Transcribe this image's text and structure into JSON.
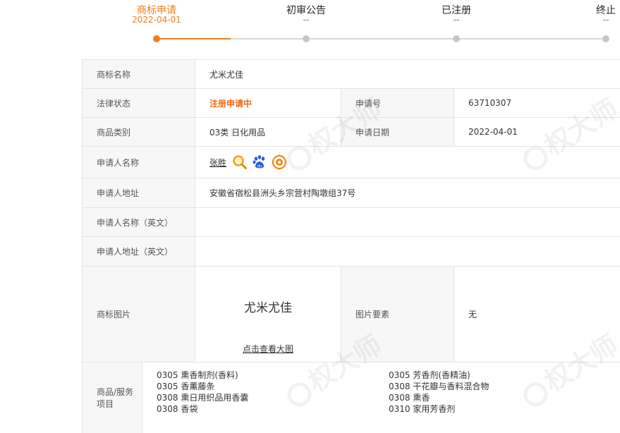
{
  "steps": [
    {
      "label": "商标申请",
      "date": "2022-04-01",
      "active": true
    },
    {
      "label": "初审公告",
      "date": "--",
      "active": false
    },
    {
      "label": "已注册",
      "date": "--",
      "active": false
    },
    {
      "label": "终止",
      "date": "--",
      "active": false
    }
  ],
  "info": {
    "name_label": "商标名称",
    "name_value": "尤米尤佳",
    "legal_status_label": "法律状态",
    "legal_status_value": "注册申请中",
    "app_no_label": "申请号",
    "app_no_value": "63710307",
    "category_label": "商品类别",
    "category_value": "03类 日化用品",
    "app_date_label": "申请日期",
    "app_date_value": "2022-04-01",
    "applicant_label": "申请人名称",
    "applicant_value": "张胜",
    "address_label": "申请人地址",
    "address_value": "安徽省宿松县洲头乡宗营村陶墩组37号",
    "applicant_en_label": "申请人名称（英文）",
    "applicant_en_value": "",
    "address_en_label": "申请人地址（英文）",
    "address_en_value": "",
    "image_label": "商标图片",
    "image_text": "尤米尤佳",
    "view_large_label": "点击查看大图",
    "image_elements_label": "图片要素",
    "image_elements_value": "无",
    "goods_label": "商品/服务项目",
    "goods_left": [
      "0305 熏香制剂(香料)",
      "0305 香薰藤条",
      "0308 熏日用织品用香囊",
      "0308 香袋"
    ],
    "goods_right": [
      "0305 芳香剂(香精油)",
      "0308 干花瓣与香料混合物",
      "0308 熏香",
      "0310 家用芳香剂"
    ]
  },
  "watermark": "权大师",
  "colors": {
    "accent": "#ef7d1f",
    "status": "#ef6a12",
    "label_bg": "#f7f7f7",
    "border": "#e3e3e3"
  },
  "icons": [
    "search-icon",
    "baidu-paw-icon",
    "target-icon"
  ]
}
